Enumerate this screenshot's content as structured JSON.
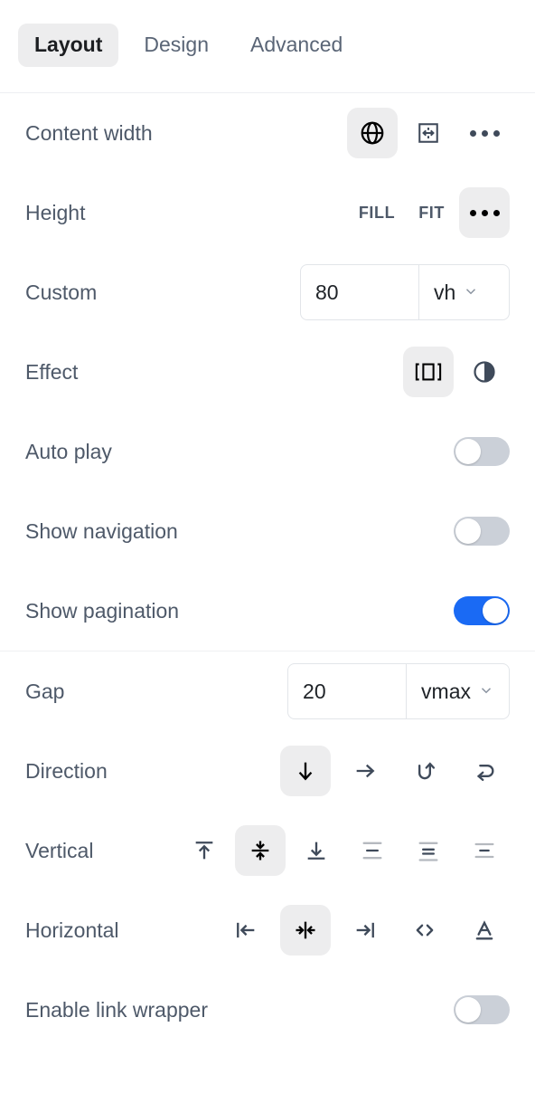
{
  "tabs": [
    {
      "label": "Layout",
      "active": true
    },
    {
      "label": "Design",
      "active": false
    },
    {
      "label": "Advanced",
      "active": false
    }
  ],
  "colors": {
    "accent": "#1A6AF4",
    "label": "#4E5969",
    "active_bg": "#EDEDEE",
    "border": "#E2E5E9",
    "toggle_off": "#CBD0D8"
  },
  "section_one": {
    "content_width": {
      "label": "Content width",
      "options": [
        {
          "icon": "globe-icon",
          "active": true
        },
        {
          "icon": "fixed-width-icon",
          "active": false
        },
        {
          "icon": "ellipsis-icon",
          "active": false
        }
      ]
    },
    "height": {
      "label": "Height",
      "options": [
        {
          "icon": "text",
          "label": "FILL",
          "active": false
        },
        {
          "icon": "text",
          "label": "FIT",
          "active": false
        },
        {
          "icon": "ellipsis-icon",
          "label": "",
          "active": true
        }
      ]
    },
    "custom": {
      "label": "Custom",
      "value": "80",
      "placeholder": "0",
      "unit": "vh"
    },
    "effect": {
      "label": "Effect",
      "options": [
        {
          "icon": "slide-effect-icon",
          "active": true
        },
        {
          "icon": "fade-effect-icon",
          "active": false
        }
      ]
    },
    "auto_play": {
      "label": "Auto play",
      "on": false
    },
    "show_navigation": {
      "label": "Show navigation",
      "on": false
    },
    "show_pagination": {
      "label": "Show pagination",
      "on": true
    }
  },
  "section_two": {
    "gap": {
      "label": "Gap",
      "value": "20",
      "placeholder": "0",
      "unit": "vmax"
    },
    "direction": {
      "label": "Direction",
      "options": [
        {
          "icon": "arrow-down-icon",
          "active": true
        },
        {
          "icon": "arrow-right-icon",
          "active": false
        },
        {
          "icon": "arrow-up-reverse-icon",
          "active": false
        },
        {
          "icon": "arrow-left-reverse-icon",
          "active": false
        }
      ]
    },
    "vertical": {
      "label": "Vertical",
      "options": [
        {
          "icon": "align-top-icon",
          "active": false
        },
        {
          "icon": "align-middle-icon",
          "active": true
        },
        {
          "icon": "align-bottom-icon",
          "active": false
        },
        {
          "icon": "space-between-vertical-icon",
          "active": false
        },
        {
          "icon": "space-around-vertical-icon",
          "active": false
        },
        {
          "icon": "space-evenly-vertical-icon",
          "active": false
        }
      ]
    },
    "horizontal": {
      "label": "Horizontal",
      "options": [
        {
          "icon": "align-left-icon",
          "active": false
        },
        {
          "icon": "align-center-icon",
          "active": true
        },
        {
          "icon": "align-right-icon",
          "active": false
        },
        {
          "icon": "stretch-icon",
          "active": false
        },
        {
          "icon": "baseline-icon",
          "active": false
        }
      ]
    },
    "enable_link_wrapper": {
      "label": "Enable link wrapper",
      "on": false
    }
  }
}
